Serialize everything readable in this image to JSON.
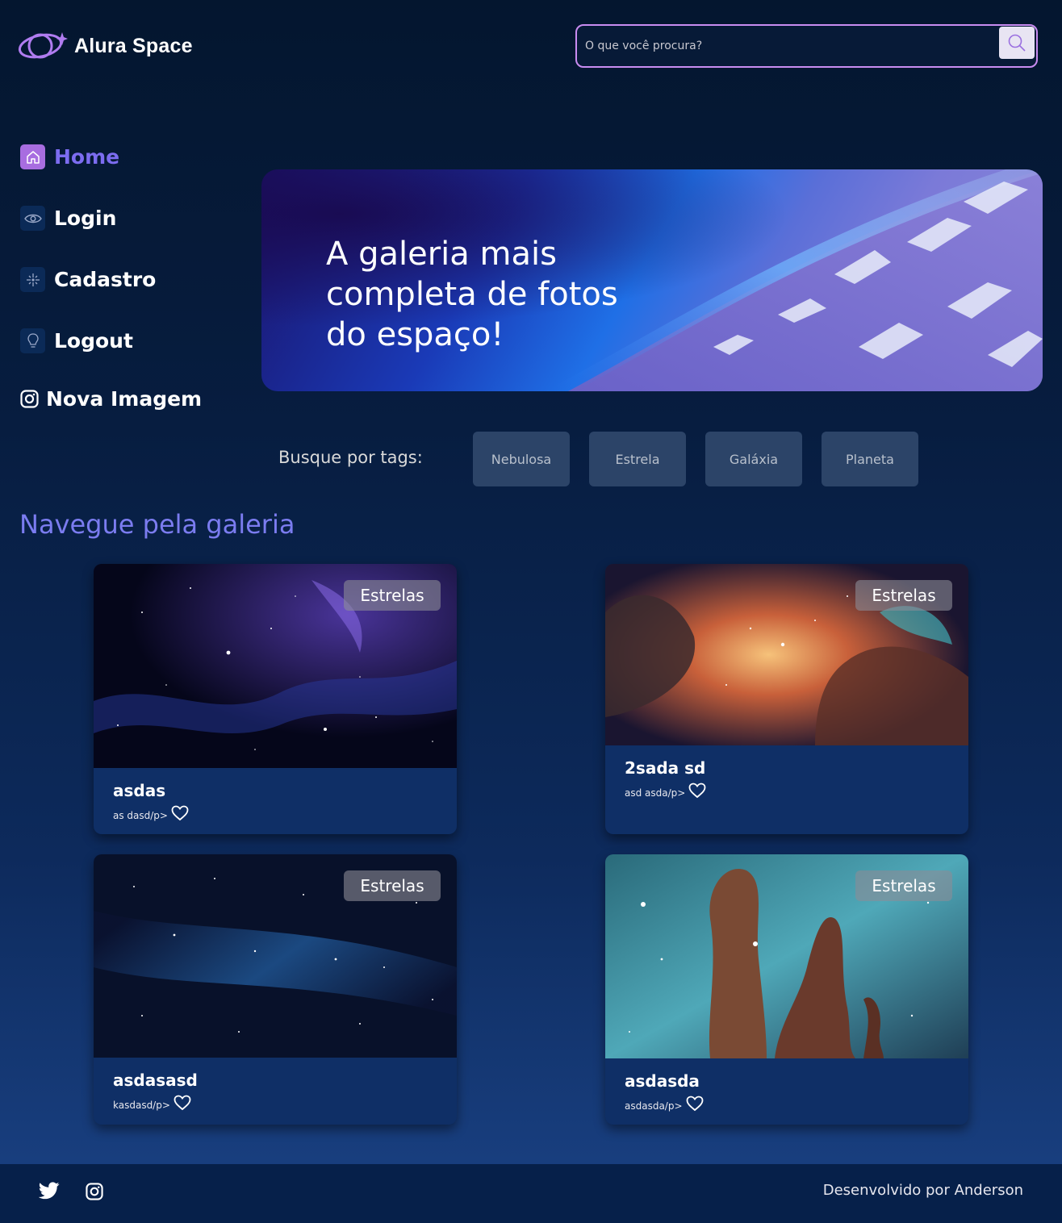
{
  "app": {
    "logo_text": "Alura Space"
  },
  "search": {
    "placeholder": "O que você procura?"
  },
  "sidebar": {
    "items": [
      {
        "label": "Home",
        "icon": "home-icon",
        "active": true
      },
      {
        "label": "Login",
        "icon": "eye-icon"
      },
      {
        "label": "Cadastro",
        "icon": "sparkle-icon"
      },
      {
        "label": "Logout",
        "icon": "lightbulb-icon"
      },
      {
        "label": "Nova Imagem",
        "icon": "instagram-icon"
      }
    ]
  },
  "banner": {
    "title": "A galeria mais completa de fotos do espaço!"
  },
  "tags": {
    "label": "Busque por tags:",
    "items": [
      "Nebulosa",
      "Estrela",
      "Galáxia",
      "Planeta"
    ]
  },
  "gallery": {
    "title": "Navegue pela galeria",
    "cards": [
      {
        "tag": "Estrelas",
        "title": "asdas",
        "desc": "as dasd/p>"
      },
      {
        "tag": "Estrelas",
        "title": "2sada sd",
        "desc": "asd asda/p>"
      },
      {
        "tag": "Estrelas",
        "title": "asdasasd",
        "desc": "kasdasd/p>"
      },
      {
        "tag": "Estrelas",
        "title": "asdasda",
        "desc": "asdasda/p>"
      }
    ]
  },
  "footer": {
    "credit": "Desenvolvido por Anderson"
  },
  "colors": {
    "accent": "#7c6cf0",
    "search_border": "#c98cf1",
    "tag_bg": "#2c4468",
    "card_bg": "#0f2f66"
  }
}
